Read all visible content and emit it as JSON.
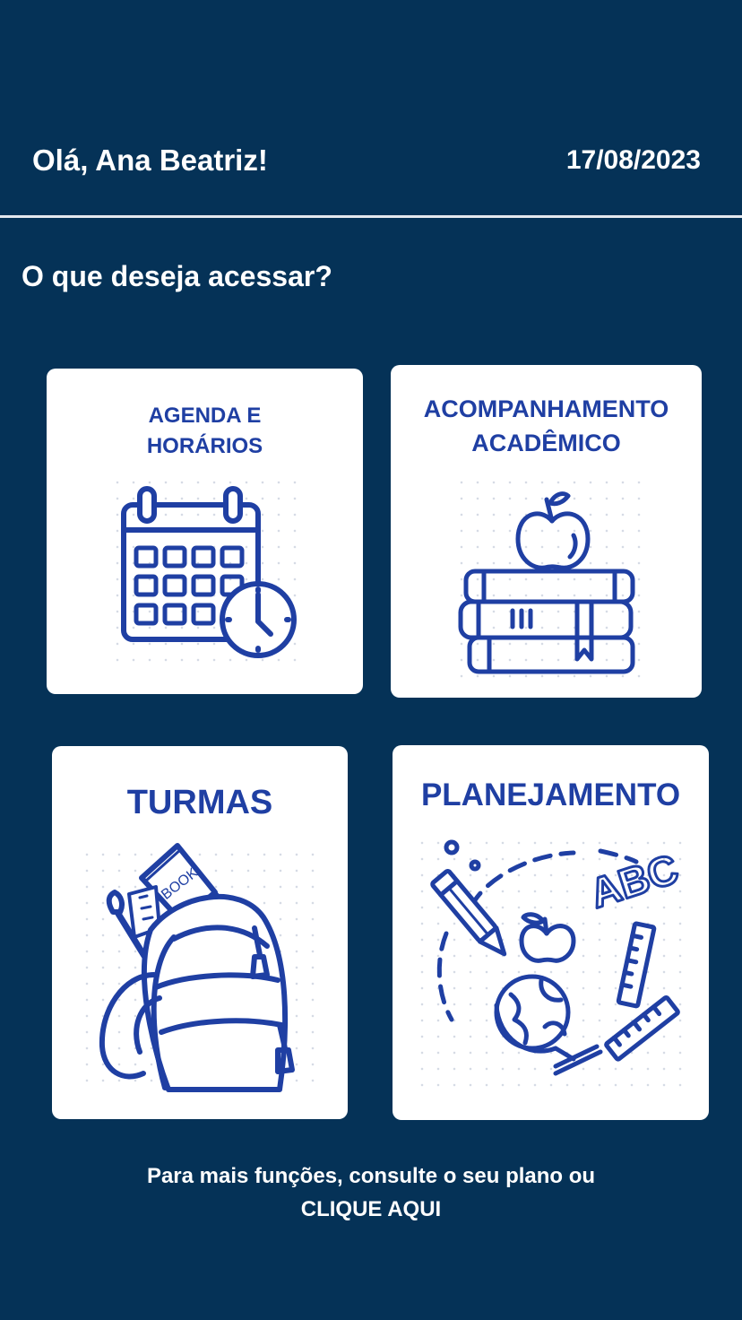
{
  "header": {
    "greeting": "Olá, Ana Beatriz!",
    "date": "17/08/2023"
  },
  "main": {
    "question": "O que deseja acessar?",
    "cards": [
      {
        "lines": [
          "AGENDA E",
          "HORÁRIOS"
        ],
        "icon": "calendar-clock-icon"
      },
      {
        "lines": [
          "ACOMPANHAMENTO",
          "ACADÊMICO"
        ],
        "icon": "apple-books-icon"
      },
      {
        "lines": [
          "TURMAS"
        ],
        "icon": "backpack-icon"
      },
      {
        "lines": [
          "PLANEJAMENTO"
        ],
        "icon": "school-supplies-icon"
      }
    ]
  },
  "footer": {
    "text": "Para mais funções, consulte o seu plano ou",
    "link": "CLIQUE AQUI"
  },
  "colors": {
    "background": "#053257",
    "card": "#ffffff",
    "accent": "#1f3fa3"
  }
}
